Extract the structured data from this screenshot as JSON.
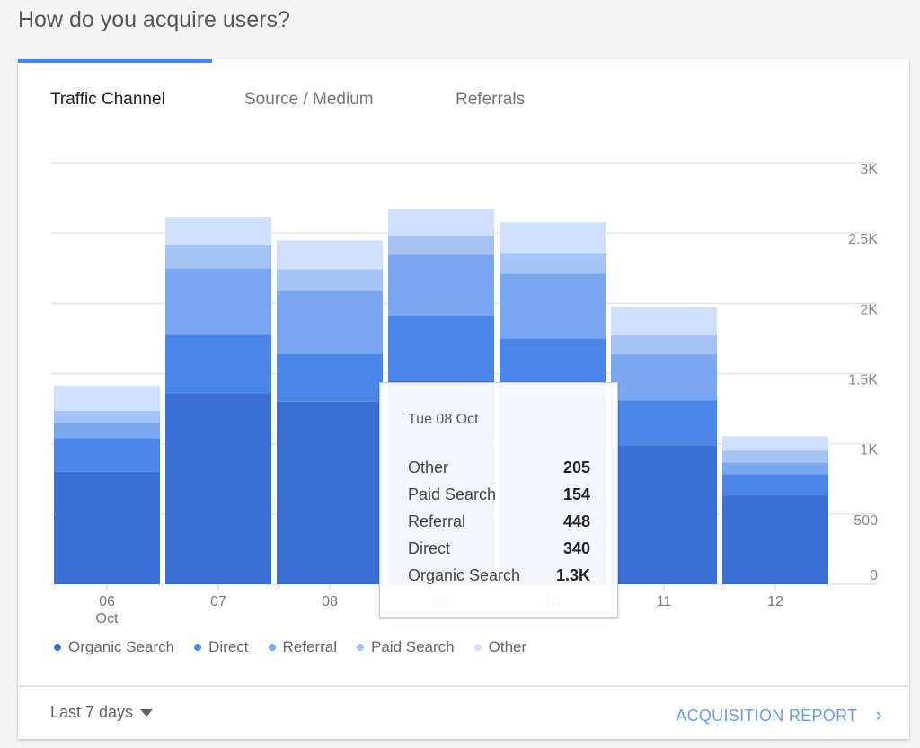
{
  "page_title": "How do you acquire users?",
  "tabs": [
    {
      "label": "Traffic Channel",
      "active": true
    },
    {
      "label": "Source / Medium",
      "active": false
    },
    {
      "label": "Referrals",
      "active": false
    }
  ],
  "accent_color": "#4285f4",
  "chart_data": {
    "type": "bar",
    "stacked": true,
    "categories": [
      "06",
      "07",
      "08",
      "09",
      "10",
      "11",
      "12"
    ],
    "x_sublabel": "Oct",
    "series": [
      {
        "name": "Organic Search",
        "color": "#3b6fd6",
        "values": [
          800,
          1360,
          1300,
          1450,
          1330,
          990,
          630
        ]
      },
      {
        "name": "Direct",
        "color": "#4a87e8",
        "values": [
          240,
          415,
          340,
          460,
          420,
          320,
          155
        ]
      },
      {
        "name": "Referral",
        "color": "#7aa7ef",
        "values": [
          110,
          475,
          448,
          436,
          462,
          327,
          83
        ]
      },
      {
        "name": "Paid Search",
        "color": "#a6c3f5",
        "values": [
          85,
          165,
          154,
          135,
          147,
          135,
          84
        ]
      },
      {
        "name": "Other",
        "color": "#d1e0fa",
        "values": [
          180,
          200,
          205,
          192,
          218,
          198,
          102
        ]
      }
    ],
    "ylim": [
      0,
      3000
    ],
    "yticks": [
      "0",
      "500",
      "1K",
      "1.5K",
      "2K",
      "2.5K",
      "3K"
    ],
    "grid": true,
    "legend_position": "bottom"
  },
  "tooltip": {
    "date": "Tue 08 Oct",
    "rows": [
      {
        "label": "Other",
        "value": "205"
      },
      {
        "label": "Paid Search",
        "value": "154"
      },
      {
        "label": "Referral",
        "value": "448"
      },
      {
        "label": "Direct",
        "value": "340"
      },
      {
        "label": "Organic Search",
        "value": "1.3K"
      }
    ]
  },
  "footer": {
    "date_range": "Last 7 days",
    "report_link": "ACQUISITION REPORT"
  }
}
